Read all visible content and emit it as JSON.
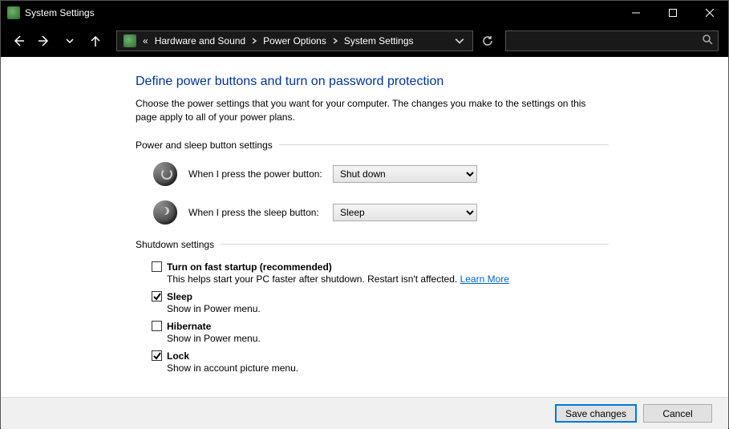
{
  "window": {
    "title": "System Settings"
  },
  "breadcrumb": {
    "prefix": "«",
    "items": [
      "Hardware and Sound",
      "Power Options",
      "System Settings"
    ]
  },
  "page": {
    "heading": "Define power buttons and turn on password protection",
    "subtext": "Choose the power settings that you want for your computer. The changes you make to the settings on this page apply to all of your power plans."
  },
  "section_power": {
    "title": "Power and sleep button settings",
    "rows": [
      {
        "label": "When I press the power button:",
        "value": "Shut down"
      },
      {
        "label": "When I press the sleep button:",
        "value": "Sleep"
      }
    ]
  },
  "section_shutdown": {
    "title": "Shutdown settings",
    "items": [
      {
        "checked": false,
        "label": "Turn on fast startup (recommended)",
        "desc": "This helps start your PC faster after shutdown. Restart isn't affected. ",
        "link": "Learn More"
      },
      {
        "checked": true,
        "label": "Sleep",
        "desc": "Show in Power menu."
      },
      {
        "checked": false,
        "label": "Hibernate",
        "desc": "Show in Power menu."
      },
      {
        "checked": true,
        "label": "Lock",
        "desc": "Show in account picture menu."
      }
    ]
  },
  "buttons": {
    "save": "Save changes",
    "cancel": "Cancel"
  }
}
